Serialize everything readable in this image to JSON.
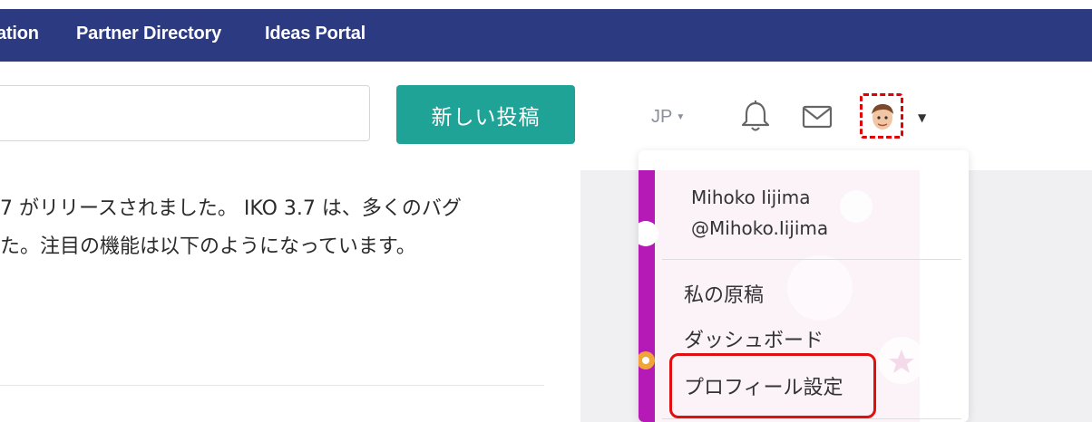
{
  "nav": {
    "links": [
      "ation",
      "Partner Directory",
      "Ideas Portal"
    ]
  },
  "header": {
    "search": {
      "value": "",
      "placeholder": ""
    },
    "new_post_label": "新しい投稿",
    "language": "JP",
    "icons": [
      "bell-icon",
      "mail-icon",
      "avatar"
    ]
  },
  "post": {
    "lines": [
      "7 がリリースされました。 IKO 3.7 は、多くのバグ",
      "た。注目の機能は以下のようになっています。"
    ]
  },
  "user_menu": {
    "name": "Mihoko Iijima",
    "handle": "@Mihoko.Iijima",
    "items": [
      "私の原稿",
      "ダッシュボード",
      "プロフィール設定"
    ]
  },
  "colors": {
    "nav_bg": "#2c3a82",
    "primary_button": "#1fa397",
    "highlight": "#e01010",
    "menu_stripe": "#b51ab7"
  }
}
